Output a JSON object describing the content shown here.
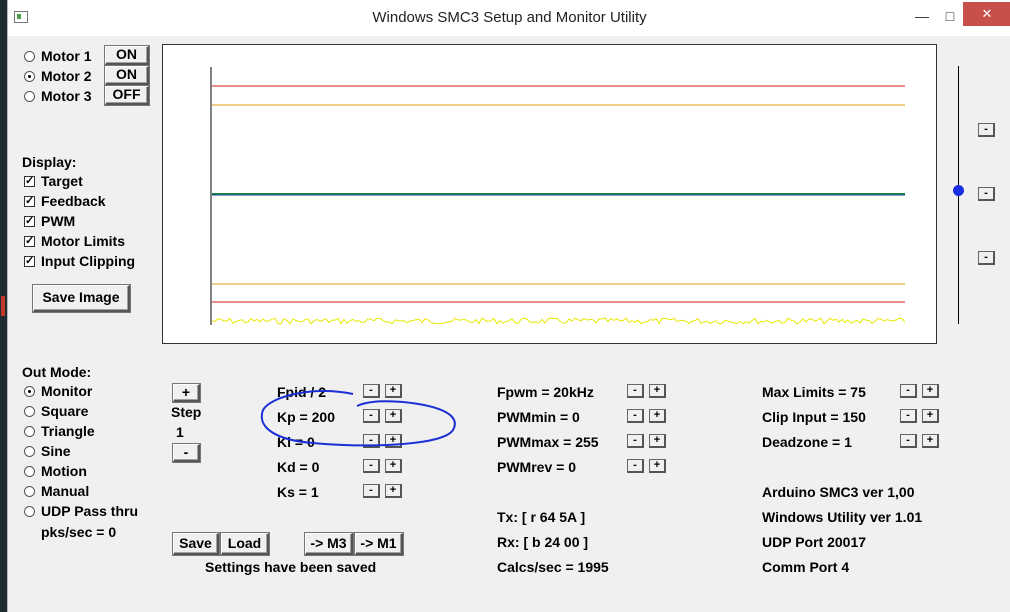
{
  "window": {
    "title": "Windows SMC3 Setup and Monitor Utility",
    "minimize": "—",
    "maximize": "□",
    "close": "✕"
  },
  "motors": [
    {
      "label": "Motor 1",
      "state": "ON",
      "selected": false
    },
    {
      "label": "Motor 2",
      "state": "ON",
      "selected": true
    },
    {
      "label": "Motor 3",
      "state": "OFF",
      "selected": false
    }
  ],
  "display": {
    "heading": "Display:",
    "items": [
      {
        "label": "Target",
        "checked": true
      },
      {
        "label": "Feedback",
        "checked": true
      },
      {
        "label": "PWM",
        "checked": true
      },
      {
        "label": "Motor Limits",
        "checked": true
      },
      {
        "label": "Input Clipping",
        "checked": true
      }
    ],
    "save_image": "Save Image"
  },
  "out_mode": {
    "heading": "Out Mode:",
    "items": [
      {
        "label": "Monitor",
        "selected": true
      },
      {
        "label": "Square",
        "selected": false
      },
      {
        "label": "Triangle",
        "selected": false
      },
      {
        "label": "Sine",
        "selected": false
      },
      {
        "label": "Motion",
        "selected": false
      },
      {
        "label": "Manual",
        "selected": false
      },
      {
        "label": "UDP Pass thru",
        "selected": false
      }
    ],
    "pks_sec": "pks/sec = 0"
  },
  "step": {
    "plus": "+",
    "label": "Step",
    "value": "1",
    "minus": "-"
  },
  "pid_params": [
    {
      "label": "Fpid / 2"
    },
    {
      "label": "Kp = 200"
    },
    {
      "label": "Ki = 0"
    },
    {
      "label": "Kd = 0"
    },
    {
      "label": "Ks = 1"
    }
  ],
  "pwm_params": [
    {
      "label": "Fpwm = 20kHz"
    },
    {
      "label": "PWMmin = 0"
    },
    {
      "label": "PWMmax = 255"
    },
    {
      "label": "PWMrev = 0"
    }
  ],
  "limit_params": [
    {
      "label": "Max Limits = 75"
    },
    {
      "label": "Clip Input = 150"
    },
    {
      "label": "Deadzone = 1"
    }
  ],
  "adjust": {
    "minus": "-",
    "plus": "+"
  },
  "comms": {
    "tx": "Tx: [ r 64 5A ]",
    "rx": "Rx: [ b 24 00 ]",
    "calcs": "Calcs/sec = 1995"
  },
  "info": {
    "arduino": "Arduino SMC3 ver 1,00",
    "windows": "Windows Utility ver 1.01",
    "udp": "UDP Port 20017",
    "comm": "Comm Port 4"
  },
  "actions": {
    "save": "Save",
    "load": "Load",
    "to_m3": "-> M3",
    "to_m1": "-> M1",
    "status": "Settings have been saved"
  },
  "graph_side_buttons": [
    "-",
    "-",
    "-"
  ],
  "colors": {
    "limit_red": "#d01818",
    "clip_orange": "#e09a10",
    "feedback_green": "#1a8a3a",
    "target_blue": "#1f3fa0",
    "pwm_yellow": "#e8e800",
    "slider_thumb": "#1a2de0",
    "annotation_blue": "#1a2fd6"
  },
  "slider": {
    "level": 0.48
  }
}
